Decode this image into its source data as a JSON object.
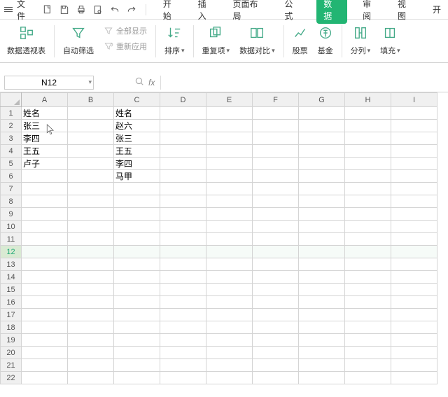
{
  "topbar": {
    "file_label": "文件",
    "tabs": {
      "start": "开始",
      "insert": "插入",
      "layout": "页面布局",
      "formula": "公式",
      "data": "数据",
      "review": "审阅",
      "view": "视图",
      "dev": "开"
    }
  },
  "ribbon": {
    "pivot": "数据透视表",
    "filter": "自动筛选",
    "show_all": "全部显示",
    "reapply": "重新应用",
    "sort": "排序",
    "dedup": "重复项",
    "compare": "数据对比",
    "stock": "股票",
    "fund": "基金",
    "splitcol": "分列",
    "fill": "填充"
  },
  "namebox": {
    "value": "N12"
  },
  "fx": {
    "label": "fx"
  },
  "columns": [
    "A",
    "B",
    "C",
    "D",
    "E",
    "F",
    "G",
    "H",
    "I"
  ],
  "rows": [
    "1",
    "2",
    "3",
    "4",
    "5",
    "6",
    "7",
    "8",
    "9",
    "10",
    "11",
    "12",
    "13",
    "14",
    "15",
    "16",
    "17",
    "18",
    "19",
    "20",
    "21",
    "22"
  ],
  "selected_row_index": 11,
  "cells": {
    "A1": "姓名",
    "A2": "张三",
    "A3": "李四",
    "A4": "王五",
    "A5": "卢子",
    "C1": "姓名",
    "C2": "赵六",
    "C3": "张三",
    "C4": "王五",
    "C5": "李四",
    "C6": "马甲"
  }
}
